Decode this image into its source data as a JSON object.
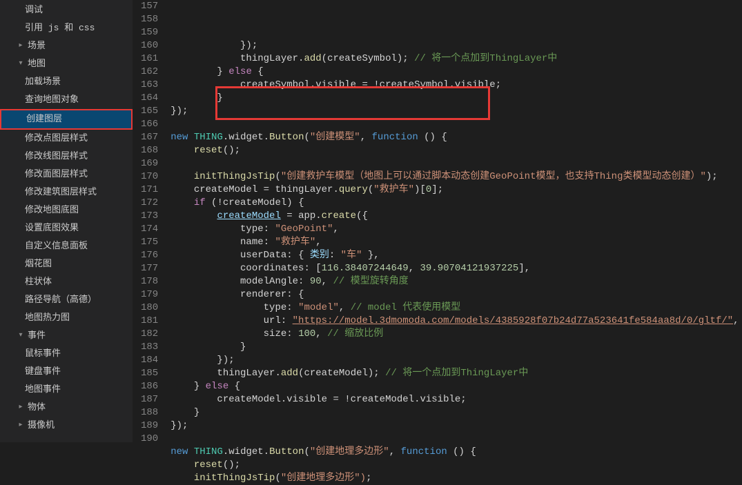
{
  "sidebar": {
    "items": [
      {
        "label": "调试",
        "indent": 2,
        "twisty": ""
      },
      {
        "label": "引用 js 和 css",
        "indent": 2,
        "twisty": ""
      },
      {
        "label": "场景",
        "indent": 1,
        "twisty": "▸"
      },
      {
        "label": "地图",
        "indent": 1,
        "twisty": "▾"
      },
      {
        "label": "加载场景",
        "indent": 2,
        "twisty": ""
      },
      {
        "label": "查询地图对象",
        "indent": 2,
        "twisty": ""
      },
      {
        "label": "创建图层",
        "indent": 2,
        "twisty": "",
        "selected": true
      },
      {
        "label": "修改点图层样式",
        "indent": 2,
        "twisty": ""
      },
      {
        "label": "修改线图层样式",
        "indent": 2,
        "twisty": ""
      },
      {
        "label": "修改面图层样式",
        "indent": 2,
        "twisty": ""
      },
      {
        "label": "修改建筑图层样式",
        "indent": 2,
        "twisty": ""
      },
      {
        "label": "修改地图底图",
        "indent": 2,
        "twisty": ""
      },
      {
        "label": "设置底图效果",
        "indent": 2,
        "twisty": ""
      },
      {
        "label": "自定义信息面板",
        "indent": 2,
        "twisty": ""
      },
      {
        "label": "烟花图",
        "indent": 2,
        "twisty": ""
      },
      {
        "label": "柱状体",
        "indent": 2,
        "twisty": ""
      },
      {
        "label": "路径导航（高德）",
        "indent": 2,
        "twisty": ""
      },
      {
        "label": "地图热力图",
        "indent": 2,
        "twisty": ""
      },
      {
        "label": "事件",
        "indent": 1,
        "twisty": "▾"
      },
      {
        "label": "鼠标事件",
        "indent": 2,
        "twisty": ""
      },
      {
        "label": "键盘事件",
        "indent": 2,
        "twisty": ""
      },
      {
        "label": "地图事件",
        "indent": 2,
        "twisty": ""
      },
      {
        "label": "物体",
        "indent": 1,
        "twisty": "▸"
      },
      {
        "label": "摄像机",
        "indent": 1,
        "twisty": "▸"
      }
    ]
  },
  "editor": {
    "startLine": 157,
    "lines": [
      {
        "type": "plain",
        "text": "            });"
      },
      {
        "type": "thing_add",
        "indent": "            ",
        "fn": "add",
        "arg": "createSymbol",
        "cmt": "// 将一个点加到ThingLayer中"
      },
      {
        "type": "else",
        "indent": "        "
      },
      {
        "type": "plain",
        "text": "            createSymbol.visible = !createSymbol.visible;"
      },
      {
        "type": "plain",
        "text": "        }"
      },
      {
        "type": "plain",
        "text": "});"
      },
      {
        "type": "blank"
      },
      {
        "type": "button",
        "label": "\"创建模型\""
      },
      {
        "type": "call",
        "indent": "    ",
        "fn": "reset"
      },
      {
        "type": "blank"
      },
      {
        "type": "tip",
        "str": "\"创建救护车模型（地图上可以通过脚本动态创建GeoPoint模型，也支持Thing类模型动态创建）\""
      },
      {
        "type": "query",
        "var": "createModel",
        "q": "\"救护车\""
      },
      {
        "type": "if",
        "var": "createModel"
      },
      {
        "type": "create",
        "var": "createModel"
      },
      {
        "type": "prop",
        "k": "type",
        "v": "\"GeoPoint\"",
        "vt": "str"
      },
      {
        "type": "prop",
        "k": "name",
        "v": "\"救护车\"",
        "vt": "str"
      },
      {
        "type": "userdata",
        "k": "类别",
        "v": "\"车\""
      },
      {
        "type": "coords",
        "a": "116.38407244649",
        "b": "39.90704121937225"
      },
      {
        "type": "prop_cmt",
        "k": "modelAngle",
        "v": "90",
        "cmt": "// 模型旋转角度"
      },
      {
        "type": "plain",
        "text": "            renderer: {"
      },
      {
        "type": "prop_cmt2",
        "k": "type",
        "v": "\"model\"",
        "cmt": "// model 代表使用模型"
      },
      {
        "type": "url",
        "v": "\"https://model.3dmomoda.com/models/4385928f07b24d77a523641fe584aa8d/0/gltf/\""
      },
      {
        "type": "prop_cmt2",
        "k": "size",
        "v": "100",
        "cmt": "// 缩放比例"
      },
      {
        "type": "plain",
        "text": "            }"
      },
      {
        "type": "plain",
        "text": "        });"
      },
      {
        "type": "thing_add",
        "indent": "        ",
        "fn": "add",
        "arg": "createModel",
        "cmt": "// 将一个点加到ThingLayer中"
      },
      {
        "type": "else",
        "indent": "    "
      },
      {
        "type": "plain",
        "text": "        createModel.visible = !createModel.visible;"
      },
      {
        "type": "plain",
        "text": "    }"
      },
      {
        "type": "plain",
        "text": "});"
      },
      {
        "type": "blank"
      },
      {
        "type": "button",
        "label": "\"创建地理多边形\""
      },
      {
        "type": "call",
        "indent": "    ",
        "fn": "reset"
      },
      {
        "type": "tip",
        "str": "\"创建地理多边形\")"
      }
    ]
  }
}
